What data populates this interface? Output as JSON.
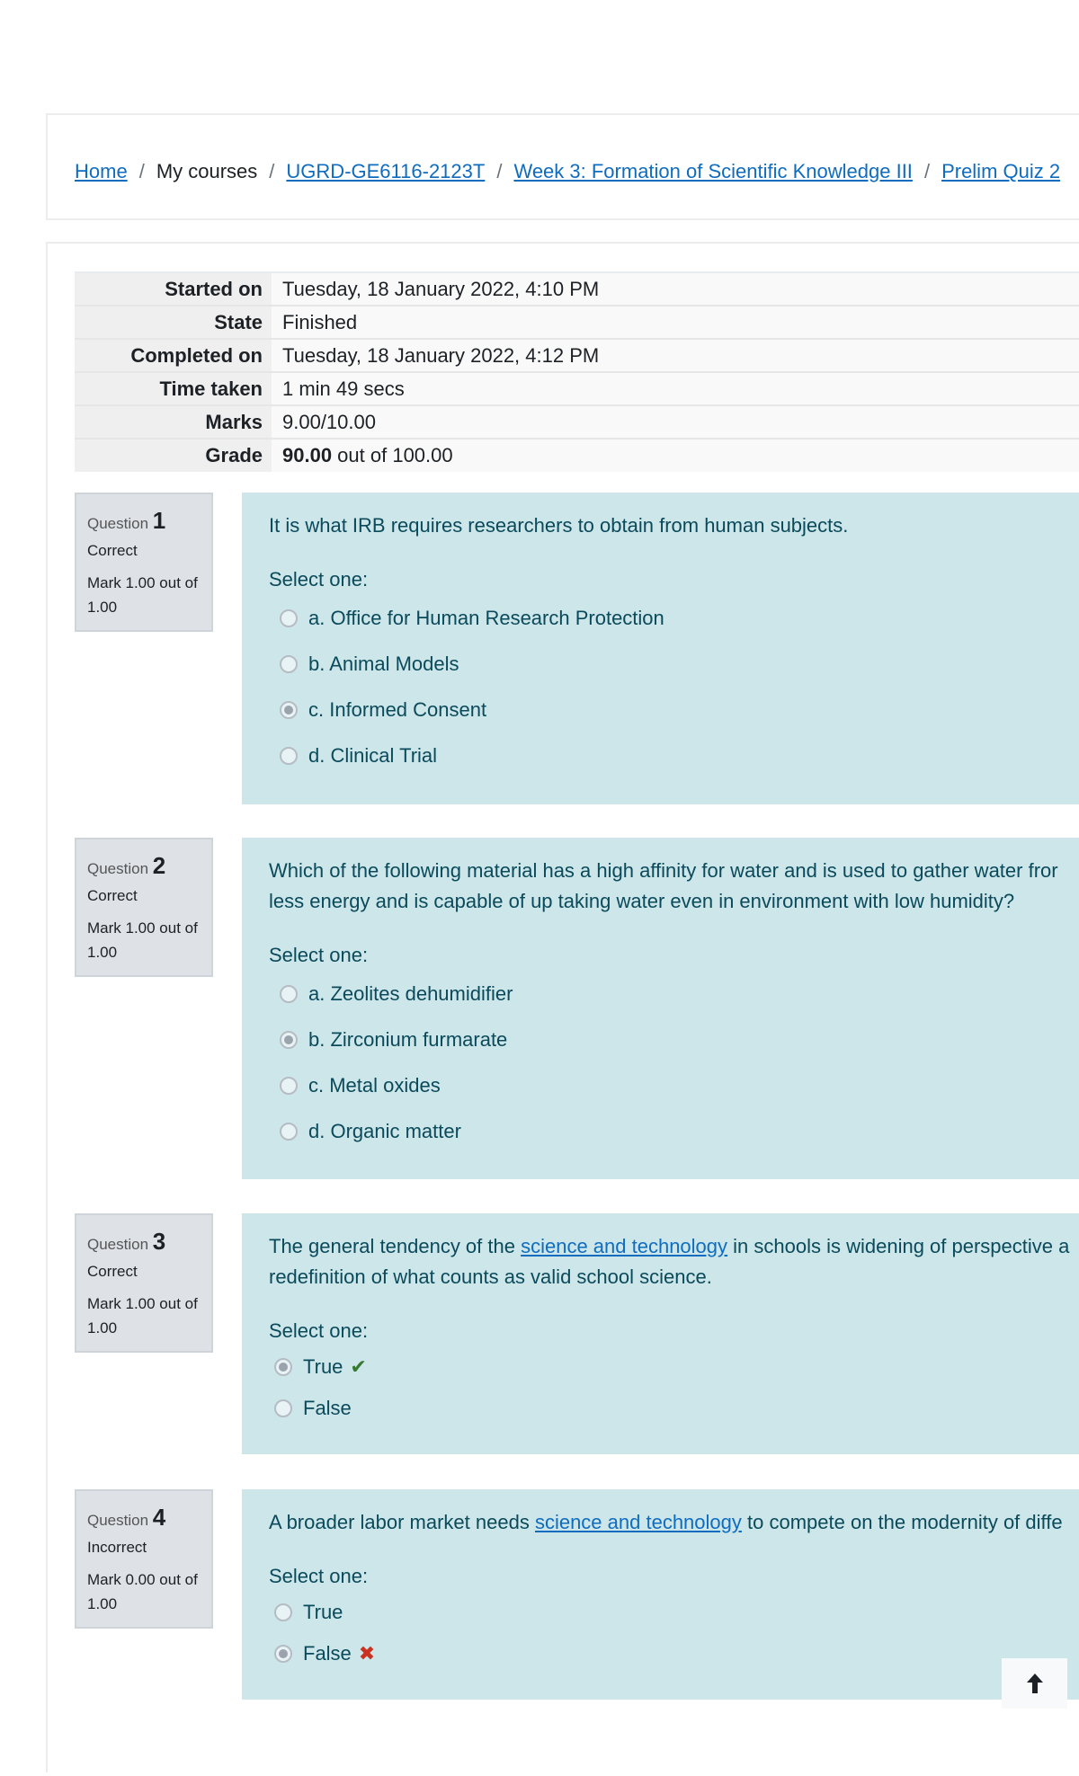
{
  "breadcrumb": {
    "items": [
      {
        "label": "Home",
        "link": true
      },
      {
        "label": "My courses",
        "link": false
      },
      {
        "label": "UGRD-GE6116-2123T",
        "link": true
      },
      {
        "label": "Week 3: Formation of Scientific Knowledge III",
        "link": true
      },
      {
        "label": "Prelim Quiz 2",
        "link": true
      }
    ],
    "separator": "/"
  },
  "summary": {
    "started_on_label": "Started on",
    "started_on": "Tuesday, 18 January 2022, 4:10 PM",
    "state_label": "State",
    "state": "Finished",
    "completed_on_label": "Completed on",
    "completed_on": "Tuesday, 18 January 2022, 4:12 PM",
    "time_taken_label": "Time taken",
    "time_taken": "1 min 49 secs",
    "marks_label": "Marks",
    "marks": "9.00/10.00",
    "grade_label": "Grade",
    "grade_value": "90.00",
    "grade_suffix": " out of 100.00"
  },
  "questions": [
    {
      "label": "Question",
      "number": "1",
      "state": "Correct",
      "mark": "Mark 1.00 out of 1.00",
      "text": "It is what IRB requires researchers to obtain from human subjects.",
      "select_one": "Select one:",
      "answers": [
        {
          "label": "a. Office for Human Research Protection",
          "checked": false
        },
        {
          "label": "b. Animal Models",
          "checked": false
        },
        {
          "label": "c. Informed Consent",
          "checked": true
        },
        {
          "label": "d. Clinical Trial",
          "checked": false
        }
      ]
    },
    {
      "label": "Question",
      "number": "2",
      "state": "Correct",
      "mark": "Mark 1.00 out of 1.00",
      "text_line1": "Which of the following material has a high affinity for water and is used to gather water fror",
      "text_line2": "less energy and is capable of up taking water even in environment with low humidity?",
      "select_one": "Select one:",
      "answers": [
        {
          "label": "a. Zeolites dehumidifier",
          "checked": false
        },
        {
          "label": "b. Zirconium furmarate",
          "checked": true
        },
        {
          "label": "c. Metal oxides",
          "checked": false
        },
        {
          "label": "d. Organic matter",
          "checked": false
        }
      ]
    },
    {
      "label": "Question",
      "number": "3",
      "state": "Correct",
      "mark": "Mark 1.00 out of 1.00",
      "text_before": "The general tendency of the ",
      "text_link": "science and technology",
      "text_after": " in schools is widening of perspective a",
      "text_line2": "redefinition of what counts as valid school science.",
      "select_one": "Select one:",
      "answers": [
        {
          "label": "True",
          "checked": true,
          "feedback": "✔",
          "feedback_type": "correct"
        },
        {
          "label": "False",
          "checked": false
        }
      ]
    },
    {
      "label": "Question",
      "number": "4",
      "state": "Incorrect",
      "mark": "Mark 0.00 out of 1.00",
      "text_before": "A broader labor market needs ",
      "text_link": "science and technology",
      "text_after": " to compete on the modernity of diffe",
      "select_one": "Select one:",
      "answers": [
        {
          "label": "True",
          "checked": false
        },
        {
          "label": "False",
          "checked": true,
          "feedback": "✖",
          "feedback_type": "incorrect"
        }
      ]
    }
  ],
  "icons": {
    "correct": "check-icon",
    "incorrect": "cross-icon",
    "scroll_top": "arrow-up-icon"
  },
  "colors": {
    "link": "#0f6cbf",
    "question_bg": "#cde6ea",
    "info_bg": "#dee2e6",
    "correct": "#357a32",
    "incorrect": "#ca3120"
  }
}
